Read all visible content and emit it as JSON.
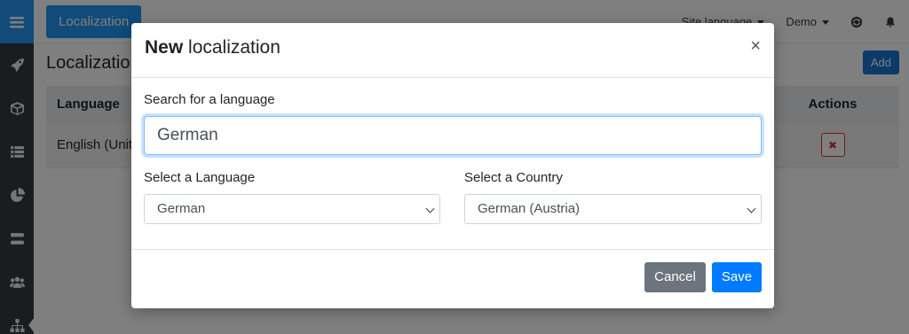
{
  "topbar": {
    "brand": "Localization",
    "site_language": "Site language",
    "user": "Demo"
  },
  "sidebar": {
    "items": [
      {
        "icon": "rocket-icon"
      },
      {
        "icon": "cube-icon"
      },
      {
        "icon": "list-icon"
      },
      {
        "icon": "pie-chart-icon"
      },
      {
        "icon": "server-icon"
      },
      {
        "icon": "users-icon"
      },
      {
        "icon": "sitemap-icon",
        "active": true
      }
    ]
  },
  "page": {
    "title": "Localization",
    "add_label": "Add",
    "table": {
      "headers": {
        "language": "Language",
        "actions": "Actions"
      },
      "rows": [
        {
          "language": "English (United States)",
          "action": "✖"
        }
      ]
    }
  },
  "modal": {
    "title_bold": "New",
    "title_rest": " localization",
    "close": "×",
    "search_label": "Search for a language",
    "search_value": "German",
    "language_label": "Select a Language",
    "language_value": "German",
    "country_label": "Select a Country",
    "country_value": "German (Austria)",
    "cancel_label": "Cancel",
    "save_label": "Save"
  },
  "colors": {
    "primary": "#007bff",
    "brand_blue": "#2196f3",
    "sidebar": "#343a40",
    "danger": "#dc3545",
    "secondary": "#6c757d"
  }
}
